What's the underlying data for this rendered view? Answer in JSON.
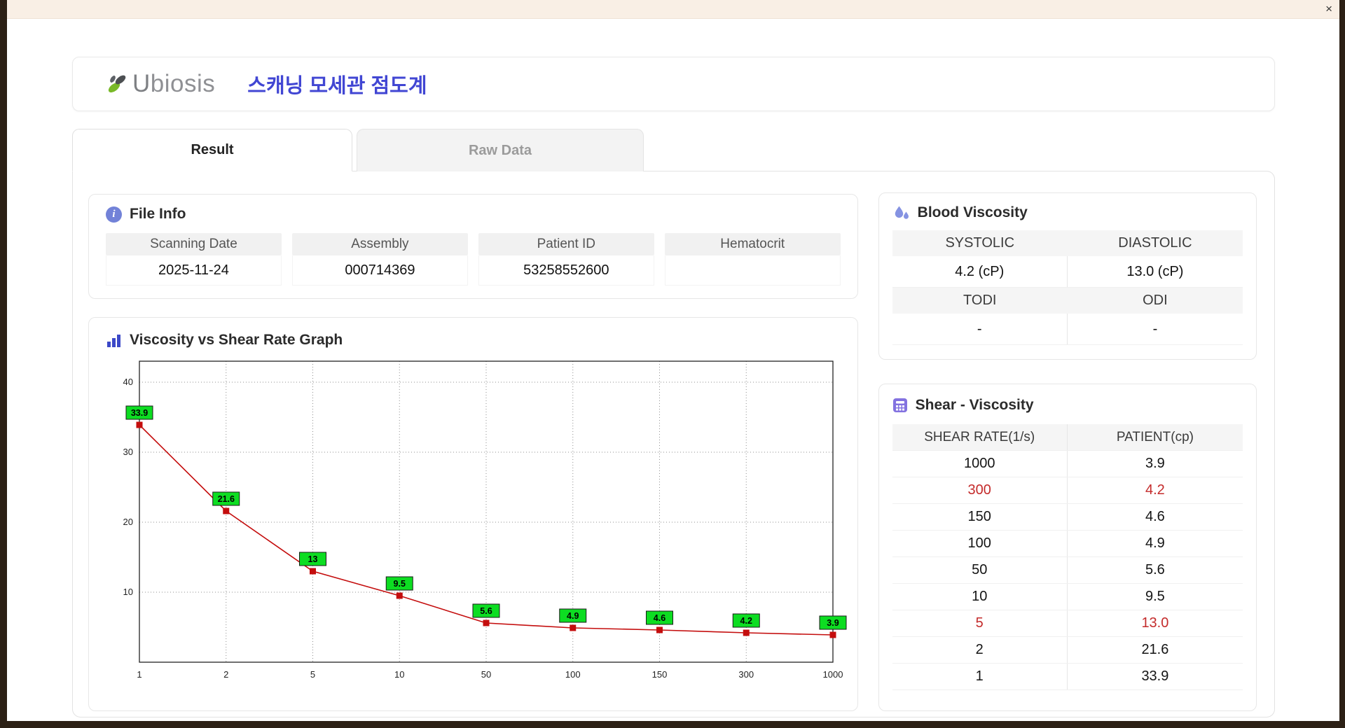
{
  "window": {
    "close_label": "×"
  },
  "header": {
    "logo_u": "U",
    "logo_rest": "biosis",
    "app_title": "스캐닝 모세관 점도계"
  },
  "tabs": [
    {
      "label": "Result",
      "active": true
    },
    {
      "label": "Raw Data",
      "active": false
    }
  ],
  "file_info": {
    "title": "File Info",
    "fields": [
      {
        "label": "Scanning Date",
        "value": "2025-11-24"
      },
      {
        "label": "Assembly",
        "value": "000714369"
      },
      {
        "label": "Patient ID",
        "value": "53258552600"
      },
      {
        "label": "Hematocrit",
        "value": ""
      }
    ]
  },
  "graph": {
    "title": "Viscosity vs Shear Rate Graph"
  },
  "blood_viscosity": {
    "title": "Blood Viscosity",
    "rows": [
      {
        "h1": "SYSTOLIC",
        "h2": "DIASTOLIC",
        "v1": "4.2 (cP)",
        "v2": "13.0 (cP)"
      },
      {
        "h1": "TODI",
        "h2": "ODI",
        "v1": "-",
        "v2": "-"
      }
    ]
  },
  "shear_viscosity": {
    "title": "Shear - Viscosity",
    "col1": "SHEAR RATE(1/s)",
    "col2": "PATIENT(cp)",
    "rows": [
      {
        "rate": "1000",
        "patient": "3.9",
        "highlight": false
      },
      {
        "rate": "300",
        "patient": "4.2",
        "highlight": true
      },
      {
        "rate": "150",
        "patient": "4.6",
        "highlight": false
      },
      {
        "rate": "100",
        "patient": "4.9",
        "highlight": false
      },
      {
        "rate": "50",
        "patient": "5.6",
        "highlight": false
      },
      {
        "rate": "10",
        "patient": "9.5",
        "highlight": false
      },
      {
        "rate": "5",
        "patient": "13.0",
        "highlight": true
      },
      {
        "rate": "2",
        "patient": "21.6",
        "highlight": false
      },
      {
        "rate": "1",
        "patient": "33.9",
        "highlight": false
      }
    ]
  },
  "chart_data": {
    "type": "line",
    "title": "Viscosity vs Shear Rate Graph",
    "x_categories": [
      "1",
      "2",
      "5",
      "10",
      "50",
      "100",
      "150",
      "300",
      "1000"
    ],
    "values": [
      33.9,
      21.6,
      13,
      9.5,
      5.6,
      4.9,
      4.6,
      4.2,
      3.9
    ],
    "point_labels": [
      "33.9",
      "21.6",
      "13",
      "9.5",
      "5.6",
      "4.9",
      "4.6",
      "4.2",
      "3.9"
    ],
    "y_ticks": [
      10,
      20,
      30,
      40
    ],
    "ylim": [
      0,
      43
    ],
    "x_scale": "log-category",
    "grid": true,
    "legend": "none",
    "line_color": "#c40d0d",
    "marker_color": "#c40d0d",
    "point_label_bg": "#0ddd22",
    "xlabel": "",
    "ylabel": ""
  },
  "colors": {
    "accent_blue": "#4146d3",
    "highlight_red": "#c42b2b",
    "logo_green": "#79b928",
    "titlebar": "#f9efe5"
  }
}
